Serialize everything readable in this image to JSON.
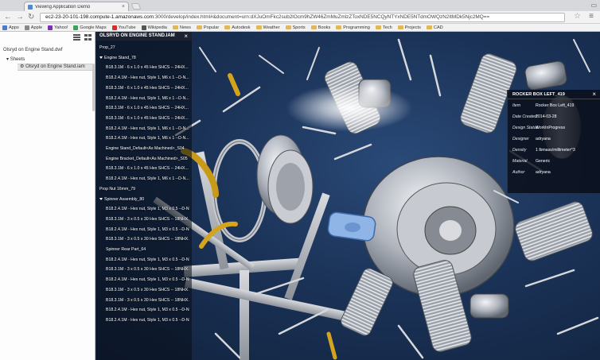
{
  "browser": {
    "tab_title": "Viewing Application Demo",
    "tab_close": "×",
    "url_host": "ec2-23-20-101-198.compute-1.amazonaws.com",
    "url_rest": ":3000/develop/index.html#&document=urn:dXJuOmFkc2sub2lOcm9hZW46ZmMuZmlzZToxNDE5NCQyNTYxNDE5NTdmOWQzN2ItMDk5Njc2MQ==",
    "back": "←",
    "forward": "→",
    "reload": "↻",
    "star": "☆",
    "menu": "≡",
    "bookmarks": [
      {
        "label": "Apps",
        "icon": "apps-icon",
        "color": "#4a7bd0"
      },
      {
        "label": "Apple",
        "icon": "apple-icon",
        "color": "#888888"
      },
      {
        "label": "Yahoo!",
        "icon": "yahoo-icon",
        "color": "#7b2fb8"
      },
      {
        "label": "Google Maps",
        "icon": "maps-icon",
        "color": "#3ca15a"
      },
      {
        "label": "YouTube",
        "icon": "youtube-icon",
        "color": "#d62d2d"
      },
      {
        "label": "Wikipedia",
        "icon": "wikipedia-icon",
        "color": "#555555"
      },
      {
        "label": "News",
        "icon": "folder-icon",
        "color": "#e0b85a"
      },
      {
        "label": "Popular",
        "icon": "folder-icon",
        "color": "#e0b85a"
      },
      {
        "label": "Autodesk",
        "icon": "folder-icon",
        "color": "#e0b85a"
      },
      {
        "label": "Weather",
        "icon": "folder-icon",
        "color": "#e0b85a"
      },
      {
        "label": "Sports",
        "icon": "folder-icon",
        "color": "#e0b85a"
      },
      {
        "label": "Books",
        "icon": "folder-icon",
        "color": "#e0b85a"
      },
      {
        "label": "Programming",
        "icon": "folder-icon",
        "color": "#e0b85a"
      },
      {
        "label": "Tech",
        "icon": "folder-icon",
        "color": "#e0b85a"
      },
      {
        "label": "Projects",
        "icon": "folder-icon",
        "color": "#e0b85a"
      },
      {
        "label": "CAD",
        "icon": "folder-icon",
        "color": "#e0b85a"
      }
    ]
  },
  "left": {
    "file": "Olsryd on Engine Stand.dwf",
    "sheets_label": "Sheets",
    "sheet_item": "Olsryd on Engine Stand.iam"
  },
  "tree": {
    "title": "OLSRYD ON ENGINE STAND.IAM",
    "close": "×",
    "items": [
      {
        "label": "Prop_27",
        "tri": false,
        "indent": 0
      },
      {
        "label": "Engine Stand_78",
        "tri": true,
        "indent": 0
      },
      {
        "label": "B18.3.1M - 6 x 1.0 x 45 Hex SHCS -- 24HX...",
        "tri": false,
        "indent": 1
      },
      {
        "label": "B18.2.4.1M - Hex nut, Style 1, M6 x 1 --D-N...",
        "tri": false,
        "indent": 1
      },
      {
        "label": "B18.3.1M - 6 x 1.0 x 45 Hex SHCS -- 24HX...",
        "tri": false,
        "indent": 1
      },
      {
        "label": "B18.2.4.1M - Hex nut, Style 1, M6 x 1 --D-N...",
        "tri": false,
        "indent": 1
      },
      {
        "label": "B18.3.1M - 6 x 1.0 x 45 Hex SHCS -- 24HX...",
        "tri": false,
        "indent": 1
      },
      {
        "label": "B18.3.1M - 6 x 1.0 x 45 Hex SHCS -- 24HX...",
        "tri": false,
        "indent": 1
      },
      {
        "label": "B18.2.4.1M - Hex nut, Style 1, M6 x 1 --D-N...",
        "tri": false,
        "indent": 1
      },
      {
        "label": "B18.2.4.1M - Hex nut, Style 1, M6 x 1 --D-N...",
        "tri": false,
        "indent": 1
      },
      {
        "label": "Engine Stand_Default<As Machined>_S04",
        "tri": false,
        "indent": 1
      },
      {
        "label": "Engine Bracket_Default<As Machined>_S05",
        "tri": false,
        "indent": 1
      },
      {
        "label": "B18.3.1M - 6 x 1.0 x 45 Hex SHCS -- 24HX...",
        "tri": false,
        "indent": 1
      },
      {
        "label": "B18.2.4.1M - Hex nut, Style 1, M6 x 1 --D-N...",
        "tri": false,
        "indent": 1
      },
      {
        "label": "Prop Nut 16mm_79",
        "tri": false,
        "indent": 0
      },
      {
        "label": "Spinner Assembly_80",
        "tri": true,
        "indent": 0
      },
      {
        "label": "B18.2.4.1M - Hex nut, Style 1, M3 x 0.5 --D-N...",
        "tri": false,
        "indent": 1
      },
      {
        "label": "B18.3.1M - 3 x 0.5 x 30 Hex SHCS -- 18NHX...",
        "tri": false,
        "indent": 1
      },
      {
        "label": "B18.2.4.1M - Hex nut, Style 1, M3 x 0.5 --D-N...",
        "tri": false,
        "indent": 1
      },
      {
        "label": "B18.3.1M - 3 x 0.5 x 30 Hex SHCS -- 18NHX...",
        "tri": false,
        "indent": 1
      },
      {
        "label": "Spinner Rear Part_64",
        "tri": false,
        "indent": 1
      },
      {
        "label": "B18.2.4.1M - Hex nut, Style 1, M3 x 0.5 --D-N...",
        "tri": false,
        "indent": 1
      },
      {
        "label": "B18.3.1M - 3 x 0.5 x 30 Hex SHCS -- 18NHX...",
        "tri": false,
        "indent": 1
      },
      {
        "label": "B18.2.4.1M - Hex nut, Style 1, M3 x 0.5 --D-N...",
        "tri": false,
        "indent": 1
      },
      {
        "label": "B18.3.1M - 3 x 0.5 x 30 Hex SHCS -- 18NHX...",
        "tri": false,
        "indent": 1
      },
      {
        "label": "B18.3.1M - 3 x 0.5 x 30 Hex SHCS -- 18NHX...",
        "tri": false,
        "indent": 1
      },
      {
        "label": "B18.2.4.1M - Hex nut, Style 1, M3 x 0.5 --D-N...",
        "tri": false,
        "indent": 1
      },
      {
        "label": "B18.2.4.1M - Hex nut, Style 1, M3 x 0.5 --D-N...",
        "tri": false,
        "indent": 1
      }
    ]
  },
  "props": {
    "title": "ROCKER BOX LEFT_419",
    "close": "×",
    "rows": [
      {
        "key": "Item",
        "value": "Rocker Box Left_419"
      },
      {
        "key": "Date Created",
        "value": "2014-03-28"
      },
      {
        "key": "Design Status",
        "value": "WorkInProgress"
      },
      {
        "key": "Designer",
        "value": "adryana"
      },
      {
        "key": "Density",
        "value": "1 lbmass/millimeter^3"
      },
      {
        "key": "Material",
        "value": "Generic"
      },
      {
        "key": "Author",
        "value": "adryana"
      }
    ]
  },
  "colors": {
    "viewer_bg": "#1b3358",
    "part_metal": "#b8bcc4",
    "part_yellow": "#c89a18",
    "part_selected": "#8fb4e6"
  }
}
